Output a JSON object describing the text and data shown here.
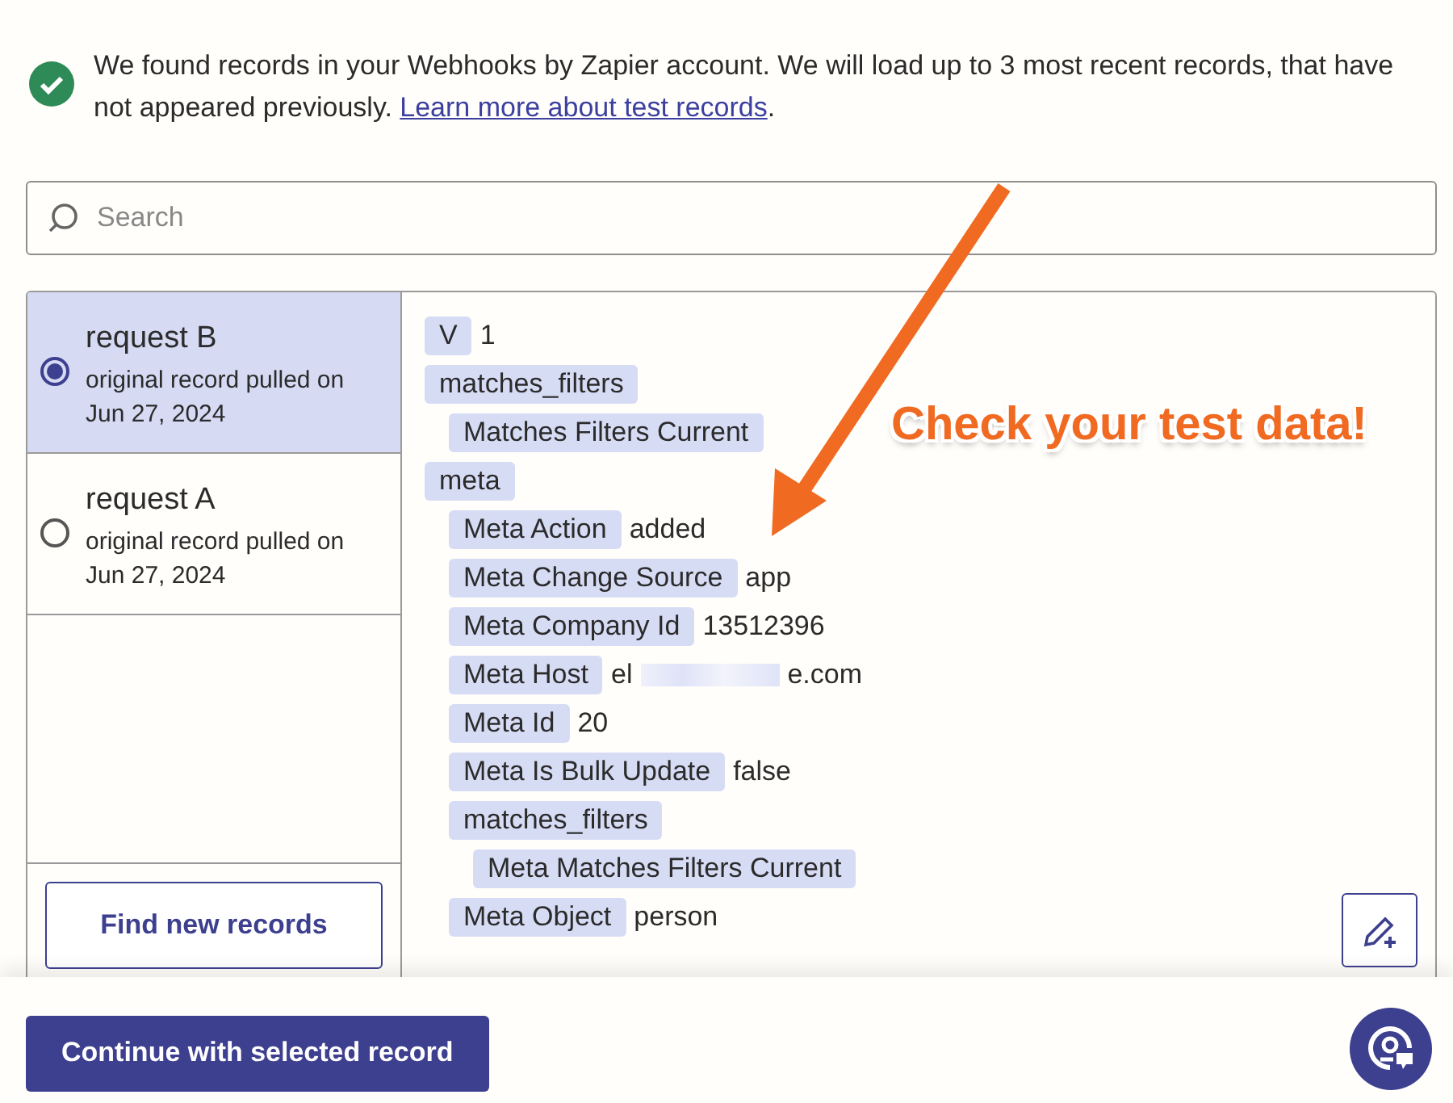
{
  "notice": {
    "text": "We found records in your Webhooks by Zapier account. We will load up to 3 most recent records, that have not appeared previously.",
    "link": "Learn more about test records",
    "after": "."
  },
  "search": {
    "placeholder": "Search"
  },
  "records": [
    {
      "title": "request B",
      "subtitle": "original record pulled on Jun 27, 2024",
      "selected": true
    },
    {
      "title": "request A",
      "subtitle": "original record pulled on Jun 27, 2024",
      "selected": false
    }
  ],
  "find_button": "Find new records",
  "fields": [
    {
      "key": "V",
      "value": "1"
    },
    {
      "key": "matches_filters",
      "children": [
        {
          "key": "Matches Filters Current"
        }
      ]
    },
    {
      "key": "meta",
      "children": [
        {
          "key": "Meta Action",
          "value": "added"
        },
        {
          "key": "Meta Change Source",
          "value": "app"
        },
        {
          "key": "Meta Company Id",
          "value": "13512396"
        },
        {
          "key": "Meta Host",
          "value": "el",
          "value_end": "e.com"
        },
        {
          "key": "Meta Id",
          "value": "20"
        },
        {
          "key": "Meta Is Bulk Update",
          "value": "false"
        },
        {
          "key": "matches_filters",
          "children": [
            {
              "key": "Meta Matches Filters Current"
            }
          ]
        },
        {
          "key": "Meta Object",
          "value": "person"
        }
      ]
    }
  ],
  "annotation": "Check your test data!",
  "continue_button": "Continue with selected record"
}
